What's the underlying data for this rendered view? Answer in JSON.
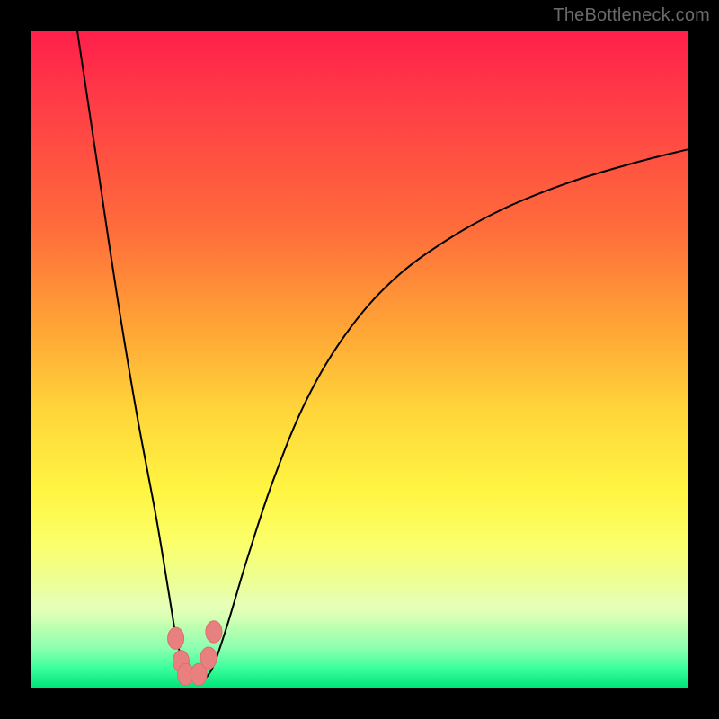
{
  "watermark": "TheBottleneck.com",
  "chart_data": {
    "type": "line",
    "title": "",
    "xlabel": "",
    "ylabel": "",
    "x_range": [
      0,
      100
    ],
    "y_range": [
      0,
      100
    ],
    "series": [
      {
        "name": "curve",
        "x": [
          7,
          10,
          13,
          16,
          19,
          21,
          22,
          23,
          24,
          25,
          26,
          27,
          28,
          30,
          33,
          37,
          42,
          48,
          55,
          63,
          72,
          82,
          92,
          100
        ],
        "y": [
          100,
          80,
          60,
          42,
          26,
          14,
          8,
          4,
          2,
          1,
          1,
          2,
          4,
          10,
          20,
          32,
          44,
          54,
          62,
          68,
          73,
          77,
          80,
          82
        ]
      }
    ],
    "markers": [
      {
        "x": 22.0,
        "y": 7.5
      },
      {
        "x": 22.8,
        "y": 4.0
      },
      {
        "x": 23.5,
        "y": 2.0
      },
      {
        "x": 25.5,
        "y": 2.0
      },
      {
        "x": 27.0,
        "y": 4.5
      },
      {
        "x": 27.8,
        "y": 8.5
      }
    ],
    "marker_style": {
      "color": "#e98080",
      "radius": 9,
      "stroke": "#de6d6d",
      "stroke_width": 1
    },
    "curve_style": {
      "color": "#000000",
      "width": 2
    }
  }
}
